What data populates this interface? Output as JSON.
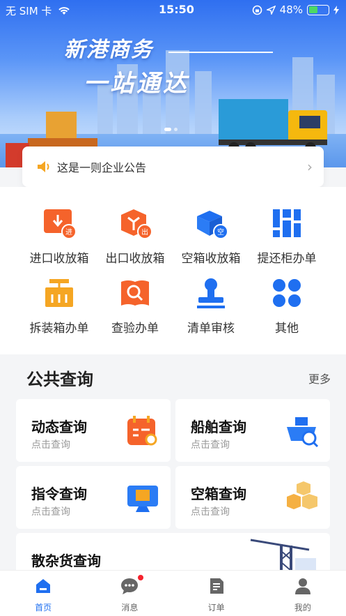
{
  "status_bar": {
    "carrier": "无 SIM 卡",
    "time": "15:50",
    "battery": "48%"
  },
  "banner": {
    "line1": "新港商务",
    "line2": "一站通达"
  },
  "notice": {
    "text": "这是一则企业公告"
  },
  "services": [
    {
      "label": "进口收放箱",
      "icon": "import-box-icon"
    },
    {
      "label": "出口收放箱",
      "icon": "export-box-icon"
    },
    {
      "label": "空箱收放箱",
      "icon": "empty-box-icon"
    },
    {
      "label": "提还柜办单",
      "icon": "grid-icon"
    },
    {
      "label": "拆装箱办单",
      "icon": "unpack-icon"
    },
    {
      "label": "查验办单",
      "icon": "inspect-icon"
    },
    {
      "label": "清单审核",
      "icon": "stamp-icon"
    },
    {
      "label": "其他",
      "icon": "other-icon"
    }
  ],
  "query": {
    "title": "公共查询",
    "more": "更多",
    "cards": [
      {
        "title": "动态查询",
        "sub": "点击查询"
      },
      {
        "title": "船舶查询",
        "sub": "点击查询"
      },
      {
        "title": "指令查询",
        "sub": "点击查询"
      },
      {
        "title": "空箱查询",
        "sub": "点击查询"
      },
      {
        "title": "散杂货查询"
      }
    ]
  },
  "tabs": [
    {
      "label": "首页"
    },
    {
      "label": "消息"
    },
    {
      "label": "订单"
    },
    {
      "label": "我的"
    }
  ],
  "colors": {
    "accent": "#1f6ff0",
    "orange": "#f57c2b",
    "blue": "#2b7cf5"
  }
}
